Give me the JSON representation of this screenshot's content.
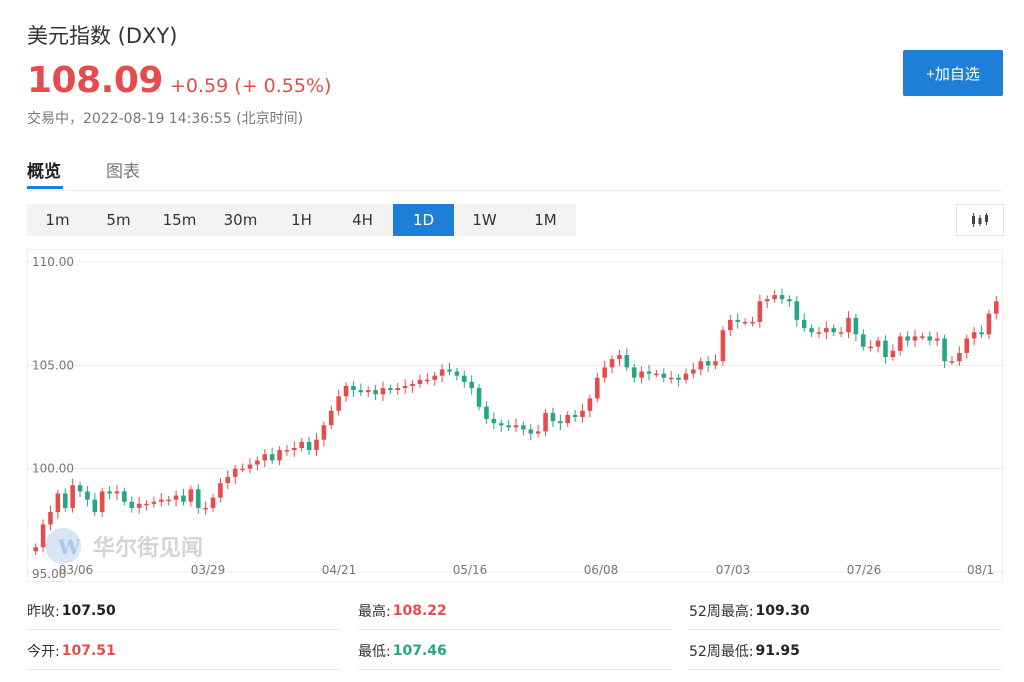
{
  "header": {
    "title": "美元指数 (DXY)",
    "price": "108.09",
    "change": "+0.59 (+ 0.55%)",
    "status": "交易中，2022-08-19 14:36:55 (北京时间)"
  },
  "add_button_label": "+加自选",
  "tabs": [
    {
      "label": "概览",
      "active": true
    },
    {
      "label": "图表",
      "active": false
    }
  ],
  "periods": [
    {
      "label": "1m"
    },
    {
      "label": "5m"
    },
    {
      "label": "15m"
    },
    {
      "label": "30m"
    },
    {
      "label": "1H"
    },
    {
      "label": "4H"
    },
    {
      "label": "1D",
      "active": true
    },
    {
      "label": "1W"
    },
    {
      "label": "1M"
    }
  ],
  "chart_type_icon": "candlestick-icon",
  "watermark": "华尔街见闻",
  "colors": {
    "up": "#e74c4c",
    "down": "#26a685",
    "accent": "#1e7fd9"
  },
  "stats": {
    "prev_close": {
      "label": "昨收:",
      "value": "107.50"
    },
    "high": {
      "label": "最高:",
      "value": "108.22"
    },
    "high_52w": {
      "label": "52周最高:",
      "value": "109.30"
    },
    "open": {
      "label": "今开:",
      "value": "107.51"
    },
    "low": {
      "label": "最低:",
      "value": "107.46"
    },
    "low_52w": {
      "label": "52周最低:",
      "value": "91.95"
    }
  },
  "chart_data": {
    "type": "candlestick",
    "y_ticks": [
      "110.00",
      "105.00",
      "100.00",
      "95.00"
    ],
    "ylim": [
      95,
      110
    ],
    "x_ticks": [
      "03/06",
      "03/29",
      "04/21",
      "05/16",
      "06/08",
      "07/03",
      "07/26",
      "08/1"
    ],
    "grid": true,
    "closes": [
      96.2,
      97.3,
      97.9,
      98.8,
      98.1,
      99.2,
      98.9,
      98.5,
      97.9,
      98.9,
      98.8,
      98.9,
      98.4,
      98.1,
      98.3,
      98.3,
      98.4,
      98.5,
      98.5,
      98.7,
      98.4,
      99.0,
      98.1,
      98.1,
      98.6,
      99.3,
      99.6,
      100.0,
      100.0,
      100.2,
      100.4,
      100.7,
      100.4,
      100.9,
      100.9,
      101.0,
      101.3,
      100.9,
      101.4,
      102.1,
      102.8,
      103.5,
      104.0,
      103.8,
      103.7,
      103.8,
      103.6,
      103.9,
      103.8,
      103.9,
      104.0,
      104.1,
      104.3,
      104.3,
      104.5,
      104.8,
      104.7,
      104.5,
      104.2,
      103.9,
      103.0,
      102.4,
      102.2,
      102.1,
      102.0,
      102.1,
      101.9,
      101.7,
      101.8,
      102.7,
      102.3,
      102.2,
      102.6,
      102.5,
      102.8,
      103.4,
      104.4,
      104.9,
      105.3,
      105.5,
      104.9,
      104.4,
      104.7,
      104.6,
      104.6,
      104.4,
      104.4,
      104.3,
      104.6,
      104.8,
      105.2,
      105.0,
      105.2,
      106.7,
      107.2,
      107.1,
      107.1,
      107.1,
      108.1,
      108.2,
      108.4,
      108.2,
      108.1,
      107.2,
      106.8,
      106.6,
      106.6,
      106.8,
      106.6,
      106.6,
      107.3,
      106.5,
      105.9,
      105.9,
      106.2,
      105.4,
      105.7,
      106.4,
      106.2,
      106.4,
      106.4,
      106.2,
      106.3,
      105.2,
      105.2,
      105.6,
      106.3,
      106.6,
      106.5,
      107.5,
      108.1
    ],
    "up_color": "#e74c4c",
    "down_color": "#26a685"
  }
}
